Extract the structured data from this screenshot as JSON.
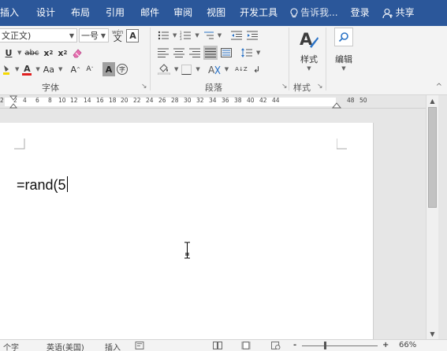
{
  "ribbon_tabs": {
    "insert": "插入",
    "design": "设计",
    "layout": "布局",
    "references": "引用",
    "mailings": "邮件",
    "review": "审阅",
    "view": "视图",
    "developer": "开发工具",
    "tell_me": "告诉我...",
    "login": "登录",
    "share": "共享"
  },
  "font_group": {
    "font_name": "文正文)",
    "font_size": "一号",
    "phonetic_guide": "wén",
    "char_border": "A",
    "underline": "U",
    "strikethrough": "abc",
    "subscript": "x",
    "superscript": "x",
    "font_color": "A",
    "change_case": "Aa",
    "grow_font": "A",
    "shrink_font": "A",
    "char_shading": "A",
    "enclose_char": "字",
    "label": "字体",
    "font_color_hex": "#e02020",
    "highlight_hex": "#f5d800"
  },
  "paragraph_group": {
    "label": "段落",
    "sort": "A↓Z"
  },
  "styles_group": {
    "styles_button": "样式",
    "label": "样式",
    "editing_button": "编辑"
  },
  "ruler": {
    "numbers": [
      "2",
      "2",
      "4",
      "6",
      "8",
      "10",
      "12",
      "14",
      "16",
      "18",
      "20",
      "22",
      "24",
      "26",
      "28",
      "30",
      "32",
      "34",
      "36",
      "38",
      "40",
      "42",
      "44",
      "48",
      "50"
    ]
  },
  "document": {
    "text": "=rand(5"
  },
  "status_bar": {
    "word_count": "个字",
    "language": "英语(美国)",
    "mode": "插入",
    "zoom": "66%",
    "zoom_minus": "-",
    "zoom_plus": "+"
  },
  "colors": {
    "title_bar": "#2b579a",
    "ribbon_bg": "#f3f3f3",
    "doc_bg": "#e6e6e6"
  }
}
